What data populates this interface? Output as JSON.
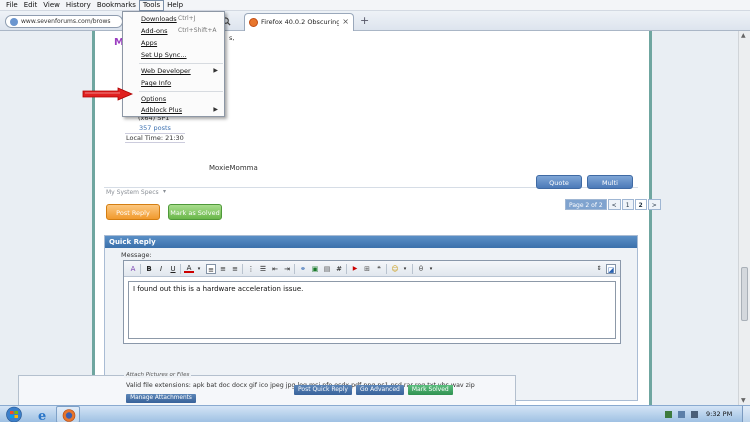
{
  "menubar": {
    "items": [
      "File",
      "Edit",
      "View",
      "History",
      "Bookmarks",
      "Tools",
      "Help"
    ],
    "active": "Tools"
  },
  "navbar": {
    "url": "www.sevenforums.com/brows"
  },
  "tab": {
    "title": "Firefox 40.0.2 Obscuring A..."
  },
  "tools_menu": {
    "items": [
      {
        "label": "Downloads",
        "shortcut": "Ctrl+J"
      },
      {
        "label": "Add-ons",
        "shortcut": "Ctrl+Shift+A"
      },
      {
        "label": "Apps"
      },
      {
        "label": "Set Up Sync..."
      },
      {
        "label": "Web Developer"
      },
      {
        "label": "Page Info"
      },
      {
        "label": "Options"
      },
      {
        "label": "Adblock Plus"
      }
    ]
  },
  "post": {
    "partial_text": "s,",
    "os": "(x64) SP1",
    "posts": "357 posts",
    "local_time": "Local Time: 21:30",
    "signature": "MoxieMomma",
    "system_specs": "My System Specs",
    "quote_label": "Quote",
    "multi_label": "Multi"
  },
  "actions": {
    "post_reply": "Post Reply",
    "mark_solved": "Mark as Solved"
  },
  "pager": {
    "label": "Page 2 of 2",
    "prev": "<",
    "p1": "1",
    "p2": "2",
    "next": ">"
  },
  "quick_reply": {
    "title": "Quick Reply",
    "message_label": "Message:",
    "message_text": "I found out this is a hardware acceleration issue.",
    "attach_legend": "Attach Pictures or Files",
    "valid_ext": "Valid file extensions: apk bat doc docx gif ico jpeg jpg log msi nfo osdx pdf png ps1 psd rar reg txt vbs wav zip",
    "manage_attachments": "Manage Attachments",
    "post_quick_reply": "Post Quick Reply",
    "go_advanced": "Go Advanced",
    "mark_solved": "Mark Solved"
  },
  "taskbar": {
    "clock": "9:32 PM"
  },
  "colors": {
    "accent": "#3a70ab",
    "menu_highlight": "#7a8fa8",
    "post_reply": "#f19a2e",
    "mark_solved": "#6ab74a",
    "arrow": "#e02020"
  }
}
